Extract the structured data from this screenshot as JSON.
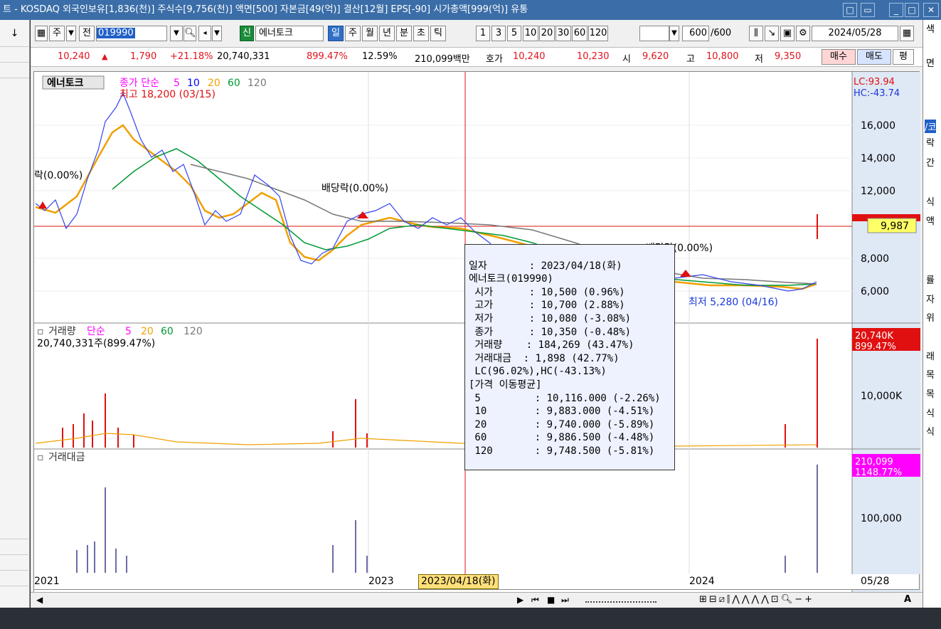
{
  "window": {
    "title": "트 - KOSDAQ 외국인보유[1,836(천)] 주식수[9,756(천)] 액면[500] 자본금[49(억)] 결산[12월] EPS[-90] 시가총액[999(억)] 유통",
    "controls": [
      "□",
      "▭",
      "_",
      "□",
      "✕"
    ]
  },
  "toolbar": {
    "jumun": "주",
    "jeon": "전",
    "stock_code": "019990",
    "sin": "신",
    "stock_name": "에너토크",
    "periods": [
      "일",
      "주",
      "월",
      "년",
      "분",
      "초",
      "틱"
    ],
    "intervals": [
      "1",
      "3",
      "5",
      "10",
      "20",
      "30",
      "60",
      "120"
    ],
    "count": "600",
    "count_total": "/600",
    "date": "2024/05/28"
  },
  "quote": {
    "price": "10,240",
    "arrow": "▲",
    "change": "1,790",
    "change_pct": "+21.18%",
    "volume": "20,740,331",
    "vol_ratio": "899.47%",
    "turnover": "12.59%",
    "amount": "210,099백만",
    "hoga_label": "호가",
    "ask": "10,240",
    "bid": "10,230",
    "open_label": "시",
    "open": "9,620",
    "high_label": "고",
    "high": "10,800",
    "low_label": "저",
    "low": "9,350",
    "buy": "매수",
    "sell": "매도",
    "eval": "평"
  },
  "price_panel": {
    "name": "에너토크",
    "ma_label": "종가 단순",
    "ma_periods": [
      "5",
      "10",
      "20",
      "60",
      "120"
    ],
    "ma_colors": [
      "#ff00ff",
      "#0000ff",
      "#f0a000",
      "#009933",
      "#777777"
    ],
    "lc": "LC:93.94",
    "hc": "HC:-43.74",
    "y_ticks": [
      "16,000",
      "14,000",
      "12,000",
      "8,000",
      "6,000"
    ],
    "current_price_tag": "9,987",
    "max_annotation": "최고 18,200 (03/15)",
    "min_annotation": "최저 5,280 (04/16)",
    "dividend_labels": [
      "락(0.00%)",
      "배당락(0.00%)",
      "배당락(0.00%)"
    ]
  },
  "volume_panel": {
    "label": "거래량",
    "ma_label": "단순",
    "ma_periods": [
      "5",
      "20",
      "60",
      "120"
    ],
    "value_text": "20,740,331주(899.47%)",
    "tag_value": "20,740K",
    "tag_pct": "899.47%",
    "y_tick": "10,000K"
  },
  "amount_panel": {
    "label": "거래대금",
    "tag_value": "210,099",
    "tag_pct": "1148.77%",
    "y_tick": "100,000"
  },
  "tooltip": {
    "lines": [
      "일자       : 2023/04/18(화)",
      "에너토크(019990)",
      " 시가      : 10,500 (0.96%)",
      " 고가      : 10,700 (2.88%)",
      " 저가      : 10,080 (-3.08%)",
      " 종가      : 10,350 (-0.48%)",
      " 거래량    : 184,269 (43.47%)",
      " 거래대금  : 1,898 (42.77%)",
      " LC(96.02%),HC(-43.13%)",
      "[가격 이동평균]",
      " 5         : 10,116.000 (-2.26%)",
      " 10        : 9,883.000 (-4.51%)",
      " 20        : 9,740.000 (-5.89%)",
      " 60        : 9,886.500 (-4.48%)",
      " 120       : 9,748.500 (-5.81%)"
    ]
  },
  "x_axis": {
    "labels": [
      "2021",
      "2023",
      "2024",
      "05/28"
    ],
    "crosshair_date": "2023/04/18(화)"
  },
  "right_panel_chars": [
    "색",
    "면",
    "/코",
    "락",
    "간",
    "식",
    "액",
    "률",
    "자",
    "위",
    "래",
    "목",
    "목",
    "식",
    "식"
  ]
}
